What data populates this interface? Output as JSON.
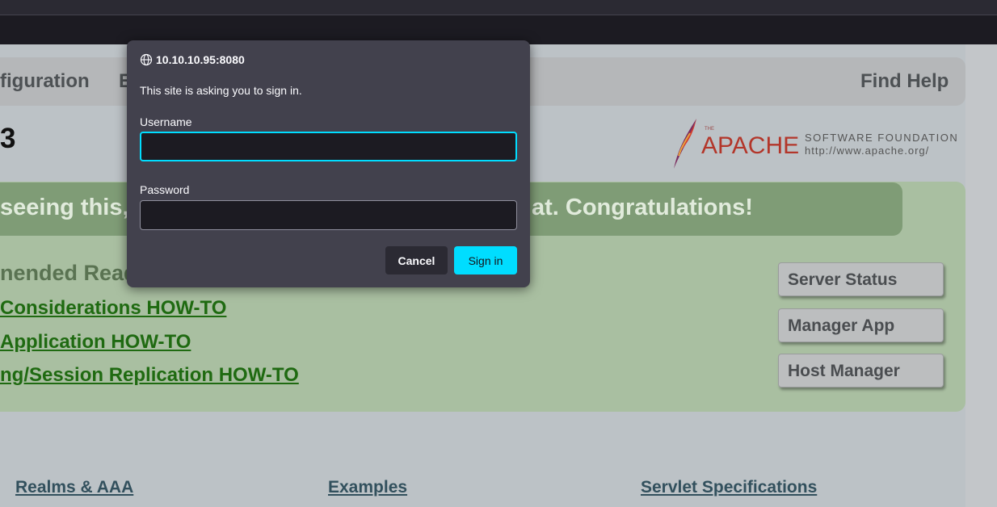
{
  "nav": {
    "left_fragment": "figuration",
    "second_fragment": "E",
    "right_item": "Find Help"
  },
  "version_fragment": "3",
  "logo": {
    "small": "THE",
    "name": "APACHE",
    "tagline": "SOFTWARE FOUNDATION",
    "url": "http://www.apache.org/"
  },
  "banner": {
    "left": "seeing this,",
    "right": "at. Congratulations!"
  },
  "recommended_heading": "nended Read",
  "howto_links": [
    "Considerations HOW-TO",
    "Application HOW-TO",
    "ng/Session Replication HOW-TO"
  ],
  "side_buttons": [
    "Server Status",
    "Manager App",
    "Host Manager"
  ],
  "bottom_links": [
    "Realms & AAA",
    "Examples",
    "Servlet Specifications"
  ],
  "dialog": {
    "host": "10.10.10.95:8080",
    "message": "This site is asking you to sign in.",
    "username_label": "Username",
    "username_value": "",
    "password_label": "Password",
    "password_value": "",
    "cancel_label": "Cancel",
    "signin_label": "Sign in"
  },
  "colors": {
    "accent": "#00ddff",
    "dialog_bg": "#42414d",
    "link_green": "#1f6a11"
  }
}
